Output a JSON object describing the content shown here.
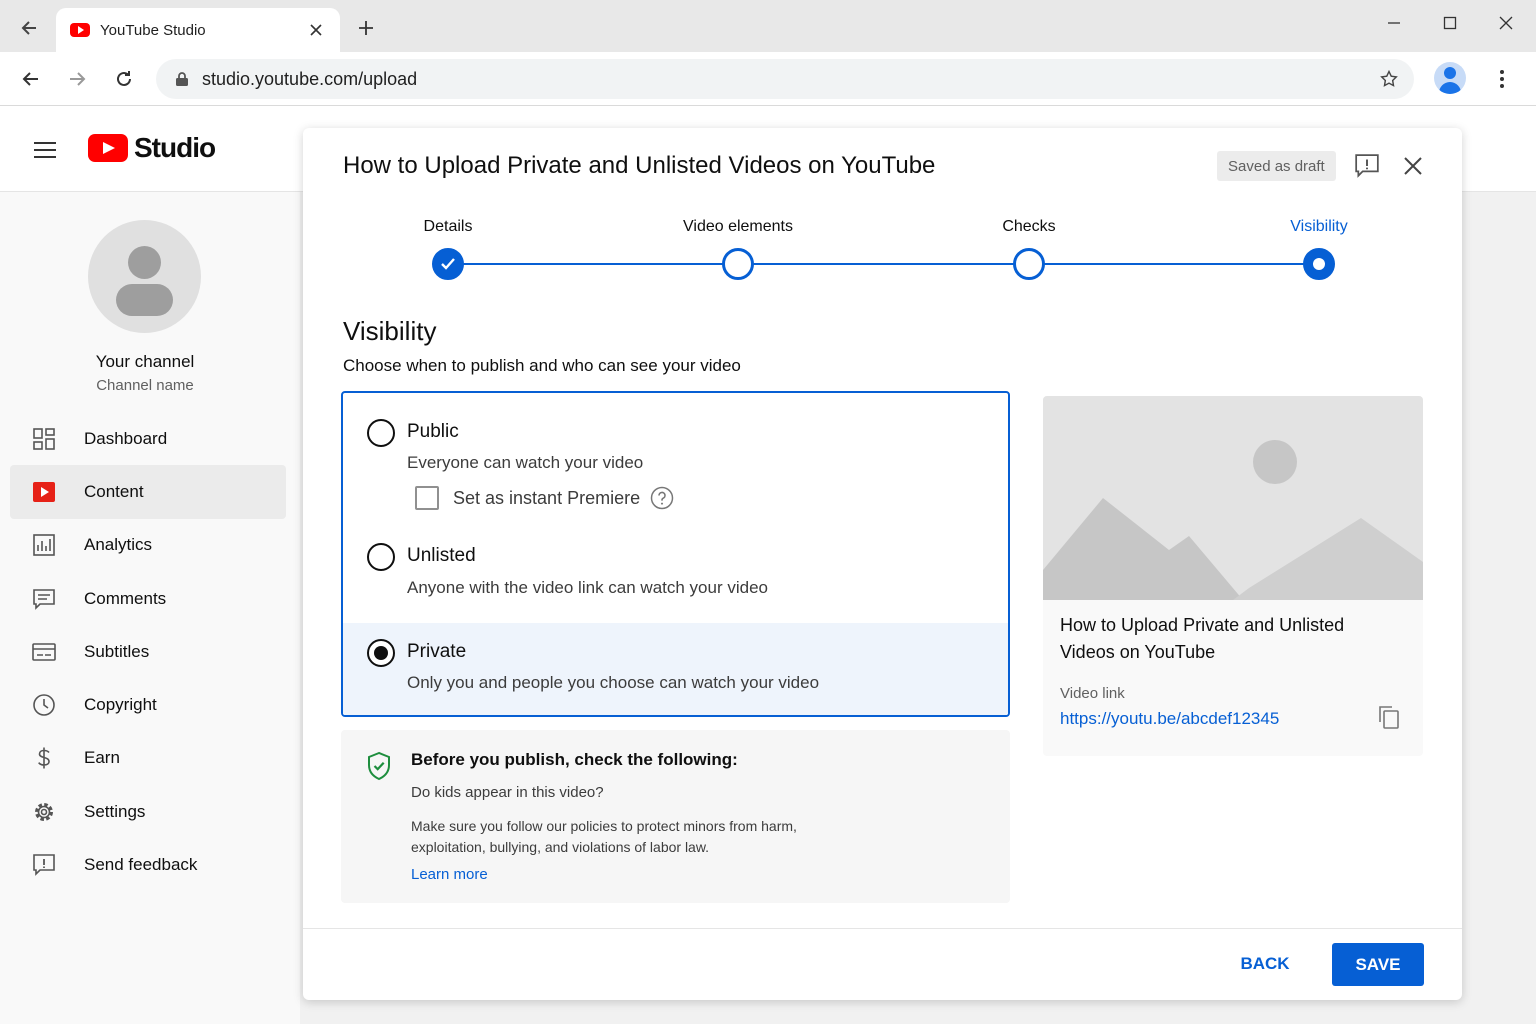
{
  "browser": {
    "tab_title": "YouTube Studio",
    "url": "studio.youtube.com/upload"
  },
  "studio": {
    "logo_text": "Studio"
  },
  "channel": {
    "title": "Your channel",
    "name": "Channel name"
  },
  "sidebar": {
    "items": [
      {
        "label": "Dashboard",
        "icon": "dashboard-icon"
      },
      {
        "label": "Content",
        "icon": "content-icon",
        "active": true
      },
      {
        "label": "Analytics",
        "icon": "analytics-icon"
      },
      {
        "label": "Comments",
        "icon": "comments-icon"
      },
      {
        "label": "Subtitles",
        "icon": "subtitles-icon"
      },
      {
        "label": "Copyright",
        "icon": "copyright-icon"
      },
      {
        "label": "Earn",
        "icon": "earn-icon"
      },
      {
        "label": "Settings",
        "icon": "settings-icon"
      },
      {
        "label": "Send feedback",
        "icon": "feedback-icon"
      }
    ]
  },
  "dialog": {
    "title": "How to Upload Private and Unlisted Videos on YouTube",
    "draft_status": "Saved as draft",
    "steps": [
      {
        "label": "Details",
        "state": "done"
      },
      {
        "label": "Video elements",
        "state": "pending"
      },
      {
        "label": "Checks",
        "state": "pending"
      },
      {
        "label": "Visibility",
        "state": "current"
      }
    ],
    "visibility": {
      "heading": "Visibility",
      "subheading": "Choose when to publish and who can see your video",
      "options": [
        {
          "label": "Public",
          "description": "Everyone can watch your video",
          "selected": false
        },
        {
          "label": "Unlisted",
          "description": "Anyone with the video link can watch your video",
          "selected": false
        },
        {
          "label": "Private",
          "description": "Only you and people you choose can watch your video",
          "selected": true
        }
      ],
      "premiere_label": "Set as instant Premiere",
      "premiere_checked": false
    },
    "checklist": {
      "title": "Before you publish, check the following:",
      "question": "Do kids appear in this video?",
      "body": "Make sure you follow our policies to protect minors from harm, exploitation, bullying, and violations of labor law.",
      "link": "Learn more"
    },
    "preview": {
      "title": "How to Upload Private and Unlisted Videos on YouTube",
      "link_label": "Video link",
      "link": "https://youtu.be/abcdef12345"
    },
    "back_label": "BACK",
    "save_label": "SAVE"
  },
  "colors": {
    "accent": "#065fd4",
    "brand_red": "#ff0000"
  }
}
